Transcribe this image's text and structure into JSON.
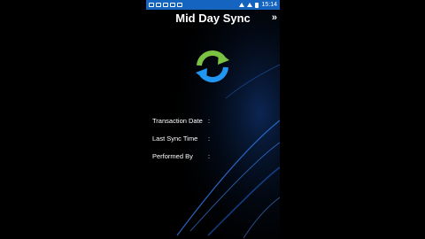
{
  "status_bar": {
    "time": "15:14",
    "icons": [
      "notification-icon",
      "message-icon",
      "image-icon",
      "email-icon",
      "calendar-icon",
      "wifi-icon",
      "signal-icon",
      "battery-icon"
    ],
    "background_color": "#1565c0"
  },
  "header": {
    "title": "Mid Day Sync",
    "nav_symbol": "»"
  },
  "sync_icon": {
    "name": "sync-refresh-icon",
    "colors": [
      "#7cc242",
      "#2196f3"
    ]
  },
  "fields": [
    {
      "label": "Transaction Date",
      "colon": ":",
      "value": ""
    },
    {
      "label": "Last Sync Time",
      "colon": ":",
      "value": ""
    },
    {
      "label": "Performed By",
      "colon": ":",
      "value": ""
    }
  ]
}
